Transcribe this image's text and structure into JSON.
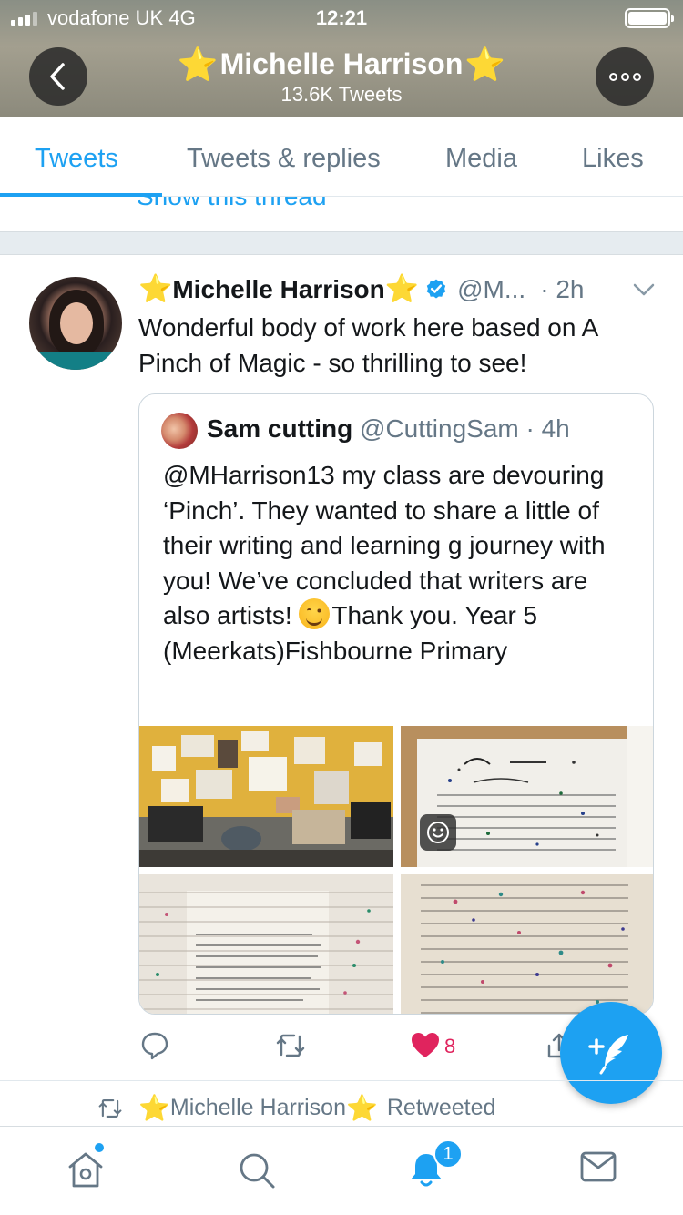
{
  "status_bar": {
    "carrier": "vodafone UK",
    "network": "4G",
    "time": "12:21"
  },
  "header": {
    "star_left": "⭐",
    "title": "Michelle Harrison",
    "star_right": "⭐",
    "tweet_count": "13.6K Tweets"
  },
  "tabs": [
    {
      "label": "Tweets",
      "active": true
    },
    {
      "label": "Tweets & replies",
      "active": false
    },
    {
      "label": "Media",
      "active": false
    },
    {
      "label": "Likes",
      "active": false
    }
  ],
  "thread_peek": "Show this thread",
  "tweet": {
    "author_name": "Michelle Harrison",
    "handle": "@M...",
    "time": "· 2h",
    "text": "Wonderful body of work here based on A Pinch of Magic - so thrilling to see!",
    "quoted": {
      "name": "Sam cutting",
      "handle_time": " @CuttingSam · 4h",
      "text_before_emoji": "@MHarrison13 my class are devouring ‘Pinch’. They wanted to share a little of their writing and learning g journey with you! We’ve concluded that writers are also artists! ",
      "emoji": "smiling-face",
      "text_after_emoji": "Thank you. Year 5 (Meerkats)Fishbourne Primary",
      "photo_count": 4
    },
    "actions": {
      "like_count": "8"
    }
  },
  "retweet_row": {
    "name": "Michelle Harrison",
    "action": "Retweeted"
  },
  "bottom_nav": {
    "notification_count": "1"
  },
  "colors": {
    "accent": "#1da1f2",
    "like": "#e0245e",
    "muted": "#657786",
    "star": "#f7c52b"
  }
}
